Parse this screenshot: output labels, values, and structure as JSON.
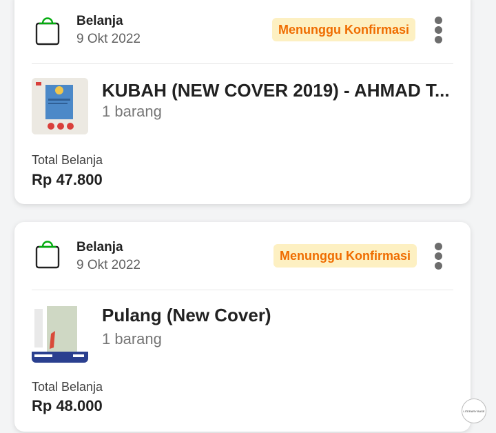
{
  "orders": [
    {
      "category": "Belanja",
      "date": "9 Okt 2022",
      "status": "Menunggu Konfirmasi",
      "product_name": "KUBAH (NEW COVER 2019) - AHMAD T...",
      "quantity": "1 barang",
      "total_label": "Total Belanja",
      "total_value": "Rp 47.800"
    },
    {
      "category": "Belanja",
      "date": "9 Okt 2022",
      "status": "Menunggu Konfirmasi",
      "product_name": "Pulang (New Cover)",
      "quantity": "1 barang",
      "total_label": "Total Belanja",
      "total_value": "Rp 48.000"
    }
  ],
  "colors": {
    "accent_green": "#03ac0e",
    "status_bg": "#fdf0c2",
    "status_text": "#ef6c00"
  },
  "icons": {
    "category": "shopping-bag-icon",
    "menu": "more-vertical-icon"
  },
  "watermark": "LITERARY BASE"
}
